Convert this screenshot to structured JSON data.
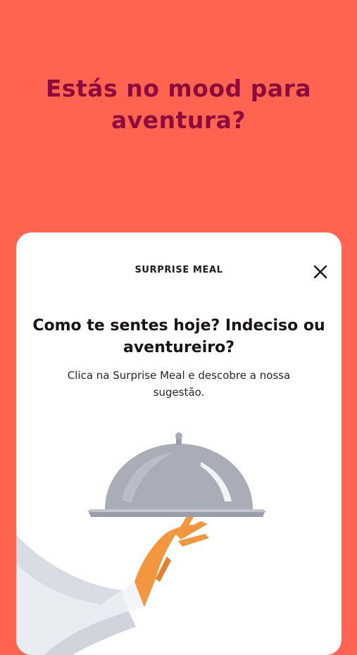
{
  "promo": {
    "headline": "Estás no mood para aventura?"
  },
  "modal": {
    "title": "SURPRISE MEAL",
    "close_icon": "close-icon",
    "question": "Como te sentes hoje? Indeciso ou aventureiro?",
    "description": "Clica na Surprise Meal e descobre a nossa sugestão.",
    "illustration": "waiter-cloche-illustration"
  },
  "colors": {
    "background": "#FF6451",
    "headline": "#8C0A3C",
    "card": "#FFFFFF",
    "text": "#1A1416",
    "cloche": "#A9ADB8",
    "hand": "#F2963F"
  }
}
